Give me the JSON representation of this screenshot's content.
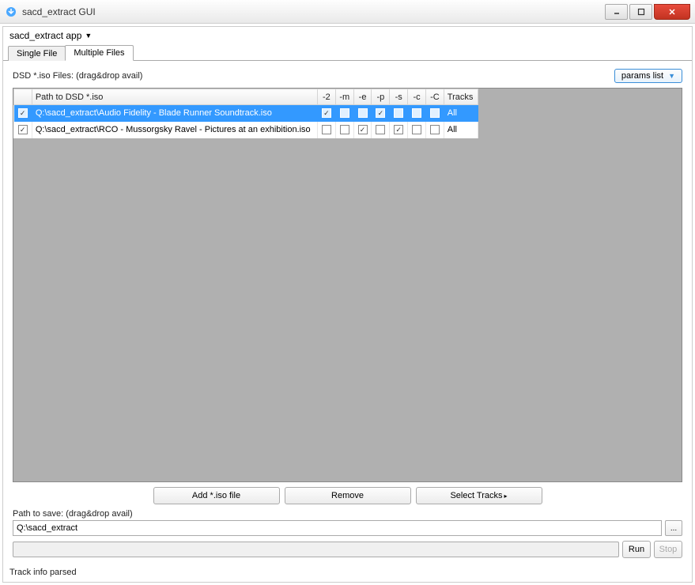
{
  "window": {
    "title": "sacd_extract GUI"
  },
  "app_dropdown": {
    "label": "sacd_extract app"
  },
  "tabs": [
    {
      "label": "Single File",
      "active": false
    },
    {
      "label": "Multiple Files",
      "active": true
    }
  ],
  "main": {
    "dsd_label": "DSD *.iso Files: (drag&drop avail)",
    "params_btn": "params list",
    "columns": {
      "path": "Path to DSD *.iso",
      "f2": "-2",
      "fm": "-m",
      "fe": "-e",
      "fp": "-p",
      "fs": "-s",
      "fc": "-c",
      "fC": "-C",
      "tracks": "Tracks"
    },
    "rows": [
      {
        "enabled": true,
        "selected": true,
        "path": "Q:\\sacd_extract\\Audio Fidelity - Blade Runner Soundtrack.iso",
        "flags": {
          "f2": true,
          "fm": false,
          "fe": false,
          "fp": true,
          "fs": false,
          "fc": false,
          "fC": false
        },
        "tracks": "All"
      },
      {
        "enabled": true,
        "selected": false,
        "path": "Q:\\sacd_extract\\RCO - Mussorgsky Ravel - Pictures at an exhibition.iso",
        "flags": {
          "f2": false,
          "fm": false,
          "fe": true,
          "fp": false,
          "fs": true,
          "fc": false,
          "fC": false
        },
        "tracks": "All"
      }
    ],
    "buttons": {
      "add": "Add *.iso file",
      "remove": "Remove",
      "select_tracks": "Select Tracks"
    },
    "save_label": "Path to save: (drag&drop avail)",
    "save_path": "Q:\\sacd_extract",
    "browse": "...",
    "run": "Run",
    "stop": "Stop"
  },
  "status": "Track info parsed"
}
